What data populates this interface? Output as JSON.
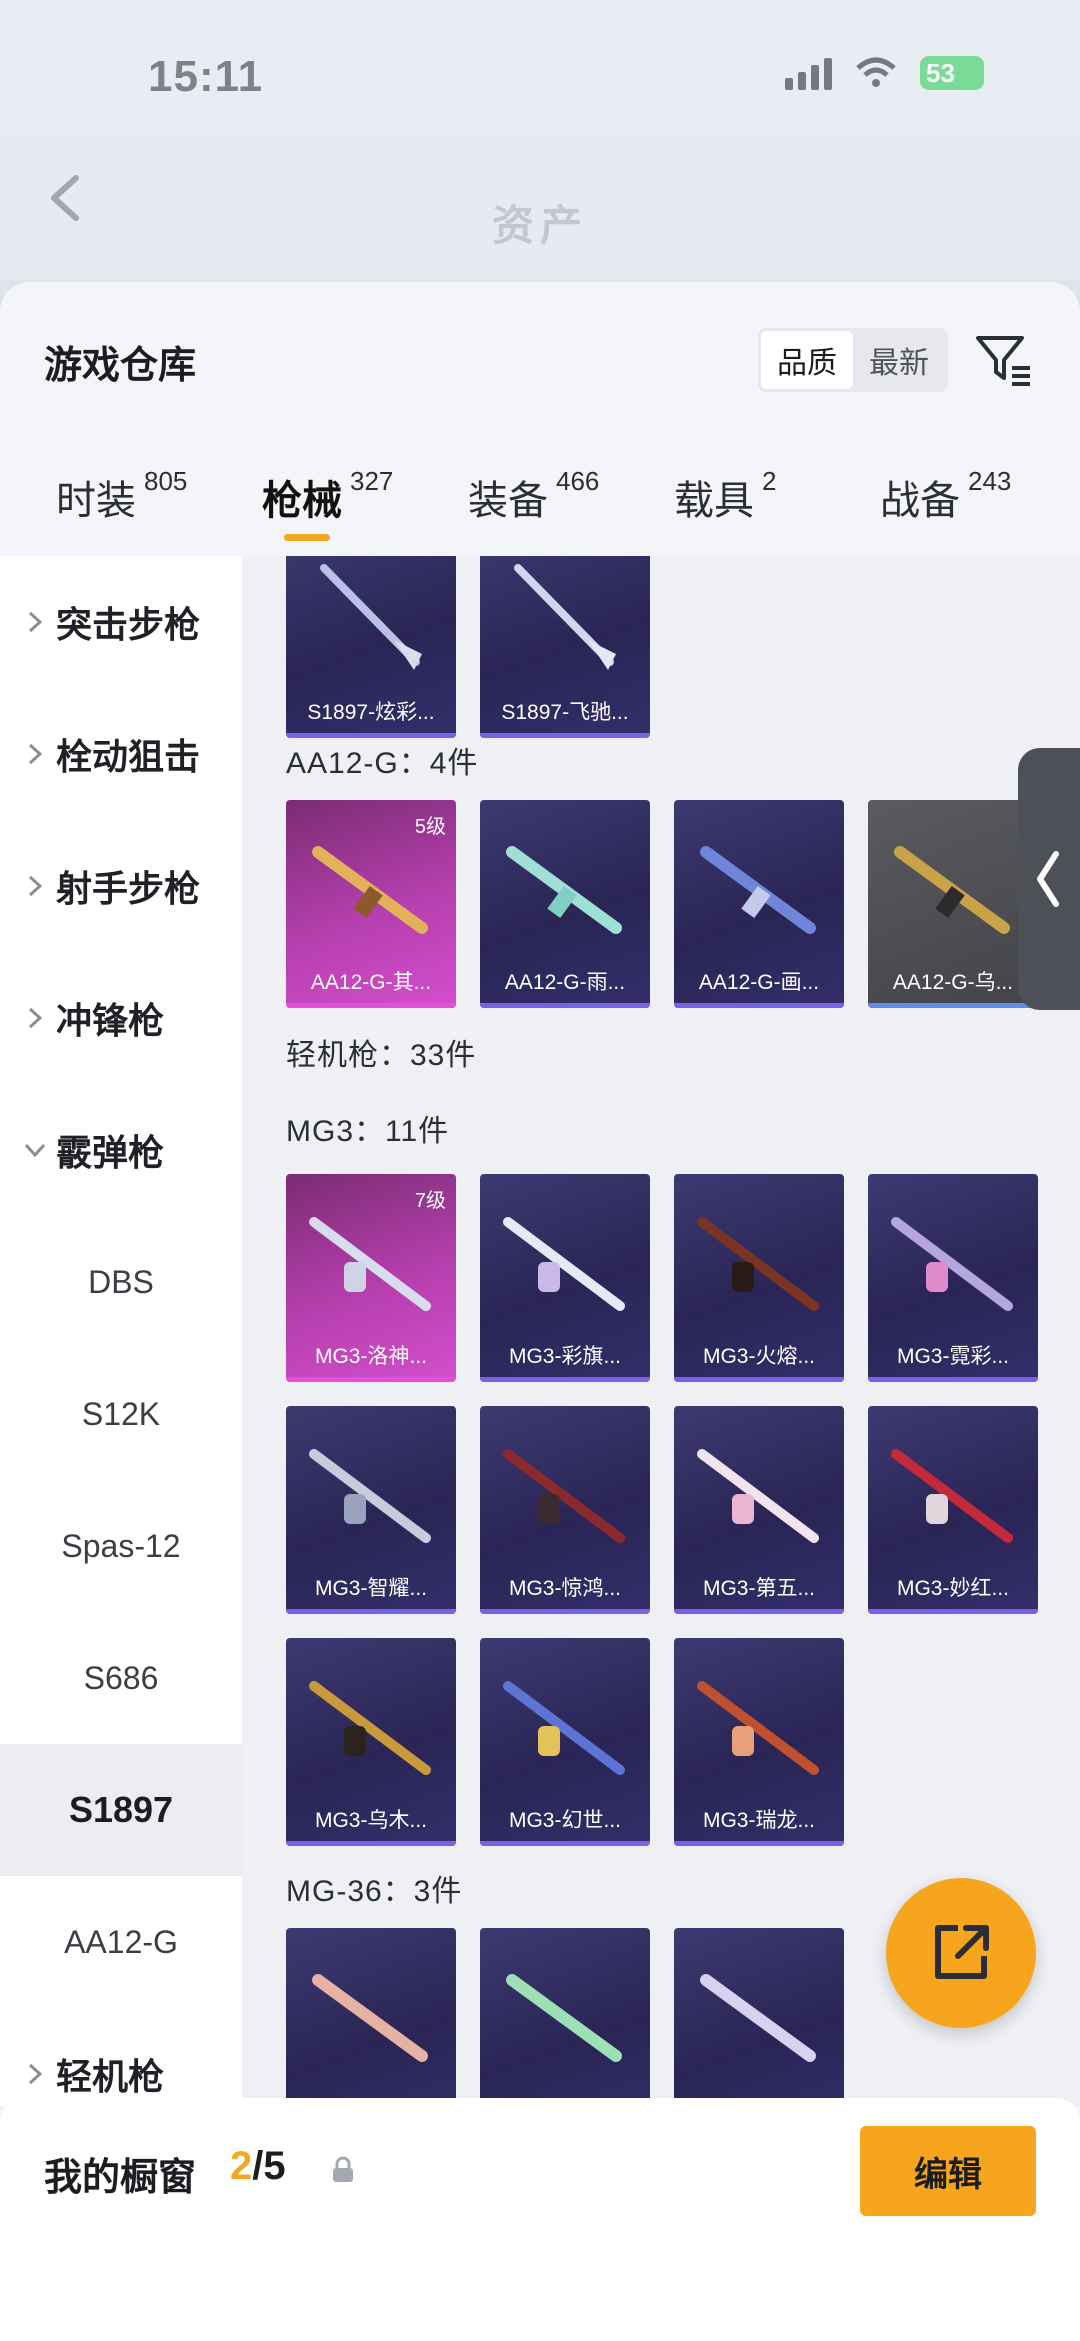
{
  "status_bar": {
    "time": "15:11",
    "battery": "53"
  },
  "header": {
    "title": "资产"
  },
  "sheet": {
    "title": "游戏仓库",
    "sort": [
      "品质",
      "最新"
    ],
    "tabs": [
      {
        "label": "时装",
        "count": "805"
      },
      {
        "label": "枪械",
        "count": "327"
      },
      {
        "label": "装备",
        "count": "466"
      },
      {
        "label": "载具",
        "count": "2"
      },
      {
        "label": "战备",
        "count": "243"
      }
    ]
  },
  "sidebar": {
    "items": [
      {
        "label": "突击步枪"
      },
      {
        "label": "栓动狙击"
      },
      {
        "label": "射手步枪"
      },
      {
        "label": "冲锋枪"
      },
      {
        "label": "霰弹枪"
      },
      {
        "label": "DBS"
      },
      {
        "label": "S12K"
      },
      {
        "label": "Spas-12"
      },
      {
        "label": "S686"
      },
      {
        "label": "S1897"
      },
      {
        "label": "AA12-G"
      },
      {
        "label": "轻机枪"
      }
    ]
  },
  "grid": {
    "top_row": [
      "S1897-炫彩...",
      "S1897-飞驰..."
    ],
    "sections": [
      {
        "label": "AA12-G：4件"
      },
      {
        "label": "轻机枪：33件"
      },
      {
        "label": "MG3：11件"
      },
      {
        "label": "MG-36：3件"
      }
    ],
    "aa12": [
      {
        "name": "AA12-G-其...",
        "level": "5级"
      },
      {
        "name": "AA12-G-雨..."
      },
      {
        "name": "AA12-G-画..."
      },
      {
        "name": "AA12-G-乌..."
      }
    ],
    "mg3": [
      {
        "name": "MG3-洛神...",
        "level": "7级"
      },
      {
        "name": "MG3-彩旗..."
      },
      {
        "name": "MG3-火熔..."
      },
      {
        "name": "MG3-霓彩..."
      },
      {
        "name": "MG3-智耀..."
      },
      {
        "name": "MG3-惊鸿..."
      },
      {
        "name": "MG3-第五..."
      },
      {
        "name": "MG3-妙红..."
      },
      {
        "name": "MG3-乌木..."
      },
      {
        "name": "MG3-幻世..."
      },
      {
        "name": "MG3-瑞龙..."
      }
    ]
  },
  "bottom": {
    "showcase_label": "我的橱窗",
    "showcase_current": "2",
    "showcase_total": "/5",
    "edit_label": "编辑"
  },
  "colors": {
    "accent": "#f7a51c",
    "card_purple": "#2a2555",
    "card_pink": "#b63fae"
  },
  "icons": [
    "back-icon",
    "filter-icon",
    "chevron-right-icon",
    "chevron-down-icon",
    "collapse-arrow-icon",
    "share-icon",
    "lock-icon",
    "signal-icon",
    "wifi-icon"
  ]
}
